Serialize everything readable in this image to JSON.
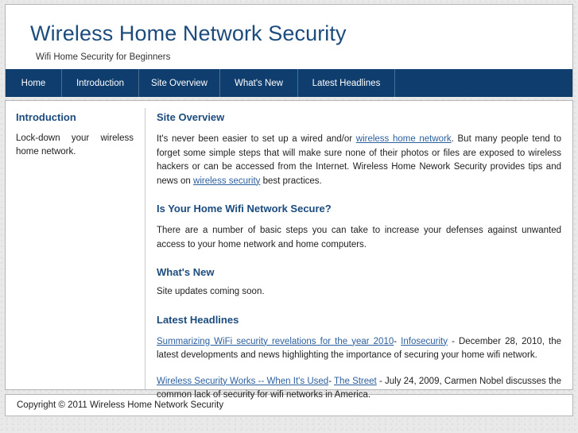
{
  "site": {
    "title": "Wireless Home Network Security",
    "tagline": "Wifi Home Security for Beginners"
  },
  "colors": {
    "nav_background": "#0f3d6e",
    "heading_blue": "#1c4b7d",
    "link_blue": "#2c5f9e",
    "page_background": "#e9e9e9",
    "panel_background": "#ffffff",
    "panel_border": "#b4b4b4"
  },
  "nav": {
    "items": [
      {
        "label": "Home"
      },
      {
        "label": "Introduction"
      },
      {
        "label": "Site Overview"
      },
      {
        "label": "What's New"
      },
      {
        "label": "Latest Headlines"
      }
    ]
  },
  "sidebar": {
    "heading": "Introduction",
    "body": "Lock-down your wireless home network."
  },
  "main": {
    "site_overview": {
      "heading": "Site Overview",
      "p1_a": "It's never been easier to set up a wired and/or ",
      "p1_link1": "wireless home network",
      "p1_b": ". But many people tend to forget some simple steps that will make sure none of their photos or files are exposed to wireless hackers or can be accessed from the Internet. Wireless Home Nework Security provides tips and news on ",
      "p1_link2": "wireless security",
      "p1_c": " best practices."
    },
    "secure": {
      "heading": "Is Your Home Wifi Network Secure?",
      "body": "There are a number of basic steps you can take to increase your defenses against unwanted access to your home network and home computers."
    },
    "whats_new": {
      "heading": "What's New",
      "body": "Site updates coming soon."
    },
    "latest_headlines": {
      "heading": "Latest Headlines",
      "items": [
        {
          "title_link": "Summarizing WiFi security revelations for the year 2010",
          "separator": "- ",
          "source_link": "Infosecurity",
          "description": " - December 28, 2010, the latest developments and news highlighting the importance of securing your home wifi network."
        },
        {
          "title_link": "Wireless Security Works -- When It's Used",
          "separator": "- ",
          "source_link": "The Street",
          "description": " - July 24, 2009, Carmen Nobel discusses the common lack of security for wifi networks in America."
        }
      ]
    }
  },
  "footer": {
    "copyright": "Copyright © 2011 Wireless Home Network Security"
  }
}
